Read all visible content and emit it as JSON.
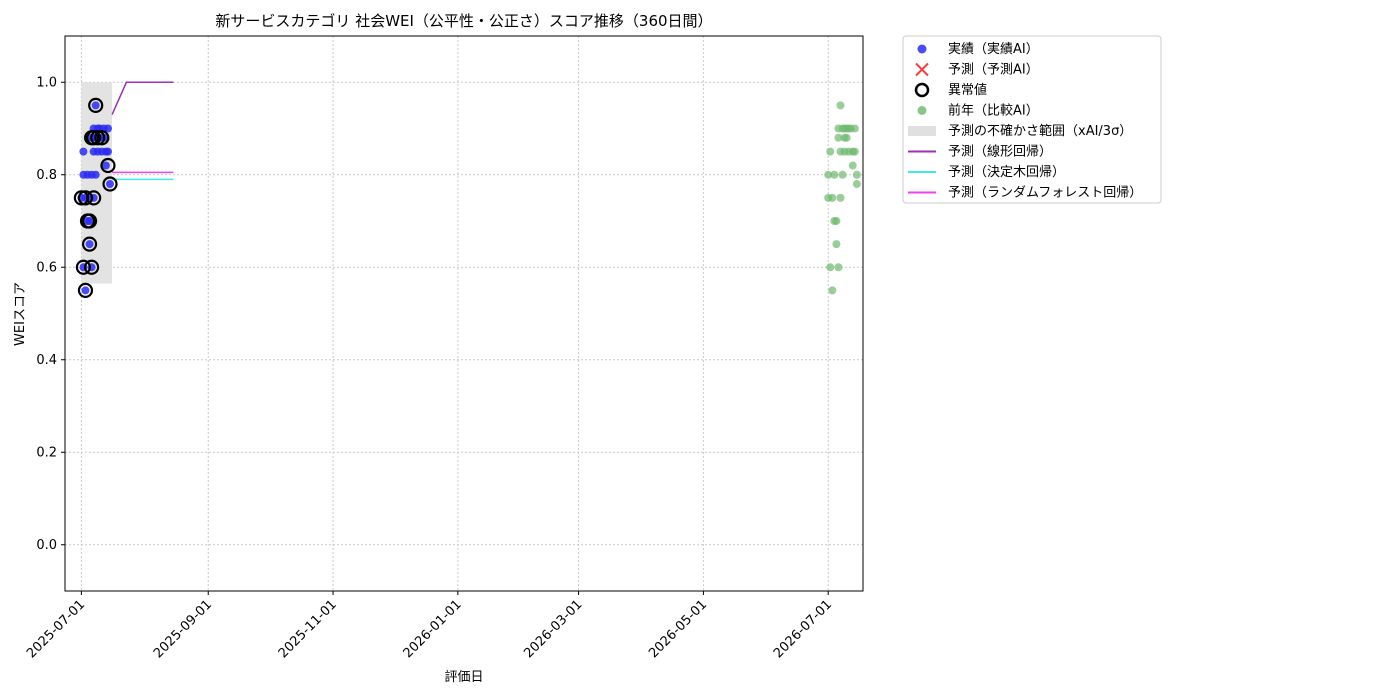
{
  "chart_data": {
    "type": "scatter",
    "title": "新サービスカテゴリ 社会WEI（公平性・公正さ）スコア推移（360日間）",
    "xlabel": "評価日",
    "ylabel": "WEIスコア",
    "xlim": [
      "2025-06-23",
      "2026-07-18"
    ],
    "ylim": [
      -0.1,
      1.1
    ],
    "grid": true,
    "legend_placement": "outside-top-right",
    "x_ticks": [
      "2025-07-01",
      "2025-09-01",
      "2025-11-01",
      "2026-01-01",
      "2026-03-01",
      "2026-05-01",
      "2026-07-01"
    ],
    "y_ticks": [
      0.0,
      0.2,
      0.4,
      0.6,
      0.8,
      1.0
    ],
    "y_tick_labels": [
      "0.0",
      "0.2",
      "0.4",
      "0.6",
      "0.8",
      "1.0"
    ],
    "legend": [
      {
        "label": "実績（実績AI）",
        "kind": "dot",
        "color": "#2b2bf0"
      },
      {
        "label": "予測（予測AI）",
        "kind": "cross",
        "color": "#f04040"
      },
      {
        "label": "異常値",
        "kind": "ring",
        "color": "#000000"
      },
      {
        "label": "前年（比較AI）",
        "kind": "dot",
        "color": "#7fbf7f"
      },
      {
        "label": "予測の不確かさ範囲（xAI/3σ）",
        "kind": "band",
        "color": "#e0e0e0"
      },
      {
        "label": "予測（線形回帰）",
        "kind": "line",
        "color": "#9b30b0"
      },
      {
        "label": "予測（決定木回帰）",
        "kind": "line",
        "color": "#40e8e8"
      },
      {
        "label": "予測（ランダムフォレスト回帰）",
        "kind": "line",
        "color": "#f040f0"
      }
    ],
    "series": [
      {
        "kind": "actual",
        "color": "#2b2bf0",
        "points": [
          {
            "x": "2025-07-01",
            "y": 0.75
          },
          {
            "x": "2025-07-02",
            "y": 0.8
          },
          {
            "x": "2025-07-02",
            "y": 0.85
          },
          {
            "x": "2025-07-02",
            "y": 0.6
          },
          {
            "x": "2025-07-03",
            "y": 0.55
          },
          {
            "x": "2025-07-03",
            "y": 0.75
          },
          {
            "x": "2025-07-04",
            "y": 0.7
          },
          {
            "x": "2025-07-04",
            "y": 0.8
          },
          {
            "x": "2025-07-05",
            "y": 0.65
          },
          {
            "x": "2025-07-05",
            "y": 0.7
          },
          {
            "x": "2025-07-05",
            "y": 0.75
          },
          {
            "x": "2025-07-06",
            "y": 0.6
          },
          {
            "x": "2025-07-06",
            "y": 0.8
          },
          {
            "x": "2025-07-06",
            "y": 0.88
          },
          {
            "x": "2025-07-07",
            "y": 0.85
          },
          {
            "x": "2025-07-07",
            "y": 0.9
          },
          {
            "x": "2025-07-07",
            "y": 0.75
          },
          {
            "x": "2025-07-08",
            "y": 0.95
          },
          {
            "x": "2025-07-08",
            "y": 0.88
          },
          {
            "x": "2025-07-08",
            "y": 0.8
          },
          {
            "x": "2025-07-09",
            "y": 0.9
          },
          {
            "x": "2025-07-09",
            "y": 0.85
          },
          {
            "x": "2025-07-10",
            "y": 0.88
          },
          {
            "x": "2025-07-10",
            "y": 0.9
          },
          {
            "x": "2025-07-11",
            "y": 0.85
          },
          {
            "x": "2025-07-12",
            "y": 0.88
          },
          {
            "x": "2025-07-12",
            "y": 0.9
          },
          {
            "x": "2025-07-13",
            "y": 0.82
          },
          {
            "x": "2025-07-13",
            "y": 0.85
          },
          {
            "x": "2025-07-14",
            "y": 0.9
          },
          {
            "x": "2025-07-14",
            "y": 0.85
          },
          {
            "x": "2025-07-15",
            "y": 0.78
          }
        ]
      },
      {
        "kind": "anomaly",
        "color": "#000000",
        "points": [
          {
            "x": "2025-07-01",
            "y": 0.75
          },
          {
            "x": "2025-07-02",
            "y": 0.6
          },
          {
            "x": "2025-07-03",
            "y": 0.55
          },
          {
            "x": "2025-07-03",
            "y": 0.75
          },
          {
            "x": "2025-07-04",
            "y": 0.7
          },
          {
            "x": "2025-07-05",
            "y": 0.65
          },
          {
            "x": "2025-07-05",
            "y": 0.7
          },
          {
            "x": "2025-07-06",
            "y": 0.6
          },
          {
            "x": "2025-07-06",
            "y": 0.88
          },
          {
            "x": "2025-07-07",
            "y": 0.75
          },
          {
            "x": "2025-07-07",
            "y": 0.88
          },
          {
            "x": "2025-07-08",
            "y": 0.95
          },
          {
            "x": "2025-07-09",
            "y": 0.88
          },
          {
            "x": "2025-07-11",
            "y": 0.88
          },
          {
            "x": "2025-07-14",
            "y": 0.82
          },
          {
            "x": "2025-07-15",
            "y": 0.78
          }
        ]
      },
      {
        "kind": "previous_year",
        "color": "#6fb86f",
        "points": [
          {
            "x": "2026-07-01",
            "y": 0.75
          },
          {
            "x": "2026-07-01",
            "y": 0.8
          },
          {
            "x": "2026-07-02",
            "y": 0.85
          },
          {
            "x": "2026-07-02",
            "y": 0.6
          },
          {
            "x": "2026-07-03",
            "y": 0.55
          },
          {
            "x": "2026-07-03",
            "y": 0.75
          },
          {
            "x": "2026-07-04",
            "y": 0.7
          },
          {
            "x": "2026-07-04",
            "y": 0.8
          },
          {
            "x": "2026-07-05",
            "y": 0.65
          },
          {
            "x": "2026-07-05",
            "y": 0.7
          },
          {
            "x": "2026-07-06",
            "y": 0.6
          },
          {
            "x": "2026-07-06",
            "y": 0.88
          },
          {
            "x": "2026-07-06",
            "y": 0.9
          },
          {
            "x": "2026-07-07",
            "y": 0.85
          },
          {
            "x": "2026-07-07",
            "y": 0.75
          },
          {
            "x": "2026-07-07",
            "y": 0.95
          },
          {
            "x": "2026-07-08",
            "y": 0.9
          },
          {
            "x": "2026-07-08",
            "y": 0.8
          },
          {
            "x": "2026-07-09",
            "y": 0.88
          },
          {
            "x": "2026-07-09",
            "y": 0.9
          },
          {
            "x": "2026-07-09",
            "y": 0.85
          },
          {
            "x": "2026-07-10",
            "y": 0.88
          },
          {
            "x": "2026-07-10",
            "y": 0.9
          },
          {
            "x": "2026-07-11",
            "y": 0.85
          },
          {
            "x": "2026-07-11",
            "y": 0.9
          },
          {
            "x": "2026-07-12",
            "y": 0.9
          },
          {
            "x": "2026-07-13",
            "y": 0.82
          },
          {
            "x": "2026-07-13",
            "y": 0.85
          },
          {
            "x": "2026-07-14",
            "y": 0.9
          },
          {
            "x": "2026-07-14",
            "y": 0.85
          },
          {
            "x": "2026-07-15",
            "y": 0.8
          },
          {
            "x": "2026-07-15",
            "y": 0.78
          }
        ]
      },
      {
        "kind": "uncertainty_band",
        "color": "#e0e0e0",
        "x_start": "2025-07-01",
        "x_end": "2025-07-16",
        "y_low": 0.565,
        "y_high": 1.0
      },
      {
        "kind": "line",
        "color": "#9b30b0",
        "points": [
          {
            "x": "2025-07-16",
            "y": 0.93
          },
          {
            "x": "2025-07-23",
            "y": 1.0
          },
          {
            "x": "2025-08-15",
            "y": 1.0
          }
        ]
      },
      {
        "kind": "line",
        "color": "#40e8e8",
        "points": [
          {
            "x": "2025-07-16",
            "y": 0.79
          },
          {
            "x": "2025-08-15",
            "y": 0.79
          }
        ]
      },
      {
        "kind": "line",
        "color": "#f040f0",
        "points": [
          {
            "x": "2025-07-16",
            "y": 0.805
          },
          {
            "x": "2025-08-15",
            "y": 0.805
          }
        ]
      }
    ]
  }
}
